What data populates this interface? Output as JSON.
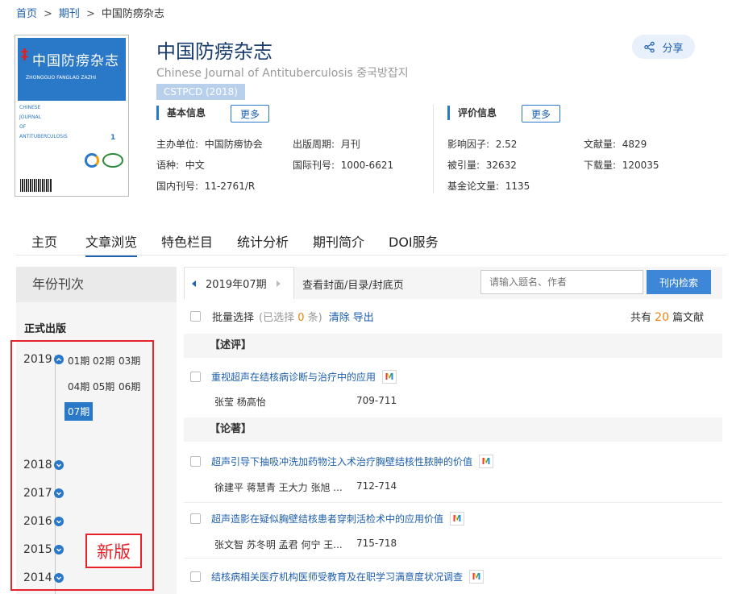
{
  "breadcrumb": {
    "home": "首页",
    "journals": "期刊",
    "current": "中国防痨杂志",
    "sep": ">"
  },
  "cover": {
    "title": "中国防痨杂志",
    "pinyin": "ZHONGGUO FANGLAO ZAZHI",
    "english": [
      "CHINESE",
      "JOURNAL",
      "OF",
      "ANTITUBERCULOSIS"
    ],
    "issue_no": "1"
  },
  "journal": {
    "title": "中国防痨杂志",
    "subtitle": "Chinese Journal of Antituberculosis 중국방잡지",
    "badge": "CSTPCD (2018)"
  },
  "share": {
    "label": "分享",
    "icon": "share-icon"
  },
  "basic_info": {
    "heading": "基本信息",
    "more": "更多",
    "sponsor_label": "主办单位:",
    "sponsor": "中国防痨协会",
    "period_label": "出版周期:",
    "period": "月刊",
    "language_label": "语种:",
    "language": "中文",
    "issn_label": "国际刊号:",
    "issn": "1000-6621",
    "cn_label": "国内刊号:",
    "cn": "11-2761/R"
  },
  "evaluation": {
    "heading": "评价信息",
    "more": "更多",
    "impact_label": "影响因子:",
    "impact": "2.52",
    "docs_label": "文献量:",
    "docs": "4829",
    "cited_label": "被引量:",
    "cited": "32632",
    "downloads_label": "下载量:",
    "downloads": "120035",
    "fund_label": "基金论文量:",
    "fund": "1135"
  },
  "tabs": [
    "主页",
    "文章浏览",
    "特色栏目",
    "统计分析",
    "期刊简介",
    "DOI服务"
  ],
  "sidebar": {
    "heading": "年份刊次",
    "section": "正式出版",
    "years": [
      "2019",
      "2018",
      "2017",
      "2016",
      "2015",
      "2014"
    ],
    "issues_2019": [
      "01期",
      "02期",
      "03期",
      "04期",
      "05期",
      "06期",
      "07期"
    ],
    "new_version": "新版"
  },
  "toolbar": {
    "issue_selected": "2019年07期",
    "cover_link": "查看封面/目录/封底页",
    "search_placeholder": "请输入题名、作者",
    "search_button": "刊内检索"
  },
  "bulk": {
    "select_label": "批量选择",
    "selected_prefix": "(已选择",
    "selected_count": "0",
    "selected_suffix": "条)",
    "clear": "清除",
    "export": "导出",
    "total_prefix": "共有",
    "total_count": "20",
    "total_suffix": "篇文献"
  },
  "categories": [
    {
      "name": "【述评】",
      "articles": [
        {
          "title": "重视超声在结核病诊断与治疗中的应用",
          "authors": "张莹 杨高怡",
          "pages": "709-711"
        }
      ]
    },
    {
      "name": "【论著】",
      "articles": [
        {
          "title": "超声引导下抽吸冲洗加药物注入术治疗胸壁结核性脓肿的价值",
          "authors": "徐建平 蒋慧青 王大力 张旭 ...",
          "pages": "712-714"
        },
        {
          "title": "超声造影在疑似胸壁结核患者穿刺活检术中的应用价值",
          "authors": "张文智 苏冬明 孟君 何宁 王...",
          "pages": "715-718"
        },
        {
          "title": "结核病相关医疗机构医师受教育及在职学习满意度状况调查",
          "authors": "",
          "pages": ""
        }
      ]
    }
  ],
  "colors": {
    "accent": "#2a78c8",
    "link": "#1e5fae",
    "highlight": "#e8222a",
    "count": "#f08010"
  }
}
